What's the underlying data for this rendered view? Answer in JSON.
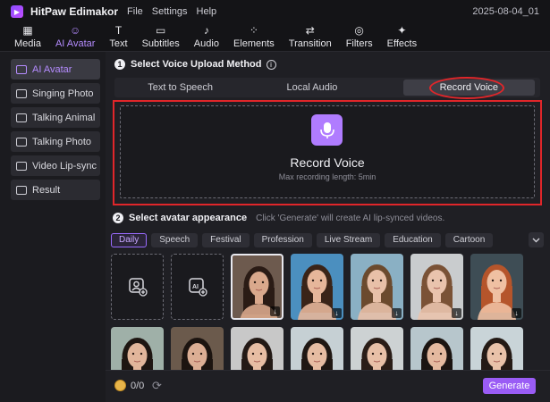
{
  "app": {
    "name": "HitPaw Edimakor",
    "project": "2025-08-04_01"
  },
  "menu": [
    "File",
    "Settings",
    "Help"
  ],
  "toolbar": [
    {
      "label": "Media",
      "icon": "media-icon"
    },
    {
      "label": "AI Avatar",
      "icon": "ai-avatar-icon",
      "active": true
    },
    {
      "label": "Text",
      "icon": "text-icon"
    },
    {
      "label": "Subtitles",
      "icon": "subtitles-icon"
    },
    {
      "label": "Audio",
      "icon": "audio-icon"
    },
    {
      "label": "Elements",
      "icon": "elements-icon"
    },
    {
      "label": "Transition",
      "icon": "transition-icon"
    },
    {
      "label": "Filters",
      "icon": "filters-icon"
    },
    {
      "label": "Effects",
      "icon": "effects-icon"
    }
  ],
  "sidebar": [
    {
      "label": "AI Avatar",
      "active": true
    },
    {
      "label": "Singing Photo"
    },
    {
      "label": "Talking Animal"
    },
    {
      "label": "Talking Photo"
    },
    {
      "label": "Video Lip-sync"
    },
    {
      "label": "Result"
    }
  ],
  "step1": {
    "number": "1",
    "title": "Select Voice Upload Method",
    "tabs": [
      "Text to Speech",
      "Local Audio",
      "Record Voice"
    ],
    "active_tab": "Record Voice"
  },
  "record": {
    "title": "Record Voice",
    "subtitle": "Max recording length: 5min"
  },
  "step2": {
    "number": "2",
    "title": "Select avatar appearance",
    "hint": "Click 'Generate' will create AI lip-synced videos."
  },
  "filters": [
    "Daily",
    "Speech",
    "Festival",
    "Profession",
    "Live Stream",
    "Education",
    "Cartoon"
  ],
  "active_filter": "Daily",
  "avatars": {
    "row1": [
      {
        "kind": "upload-photo"
      },
      {
        "kind": "ai-generate"
      },
      {
        "kind": "portrait",
        "selected": true,
        "bg": "#6d5a4e",
        "skin": "#d9a88c",
        "hair": "#2a1b15"
      },
      {
        "kind": "portrait",
        "bg": "#4b8fbf",
        "skin": "#e6b69a",
        "hair": "#3a2418"
      },
      {
        "kind": "portrait",
        "bg": "#8ab0c4",
        "skin": "#e8c0a8",
        "hair": "#6b4a2e"
      },
      {
        "kind": "portrait",
        "bg": "#c9ccce",
        "skin": "#e9c3ad",
        "hair": "#7a5236"
      },
      {
        "kind": "portrait",
        "bg": "#3e4d55",
        "skin": "#efc0a2",
        "hair": "#b5552b"
      }
    ],
    "row2": [
      {
        "bg": "#9fb0a8",
        "skin": "#e2b69b",
        "hair": "#1e1612"
      },
      {
        "bg": "#6b5a4c",
        "skin": "#dcae94",
        "hair": "#1c1410"
      },
      {
        "bg": "#c8c8c8",
        "skin": "#e7bda3",
        "hair": "#231915"
      },
      {
        "bg": "#c6d0d4",
        "skin": "#e6bca2",
        "hair": "#1f1713"
      },
      {
        "bg": "#cdd2d3",
        "skin": "#e8c0a7",
        "hair": "#2a1d17"
      },
      {
        "bg": "#b7c6cc",
        "skin": "#e4b99f",
        "hair": "#1b1411"
      },
      {
        "bg": "#c9d4d8",
        "skin": "#e9c2a9",
        "hair": "#241a15"
      }
    ]
  },
  "footer": {
    "credits": "0/0",
    "generate": "Generate"
  },
  "colors": {
    "accent": "#9a5cf5",
    "annotation": "#e0262a"
  }
}
